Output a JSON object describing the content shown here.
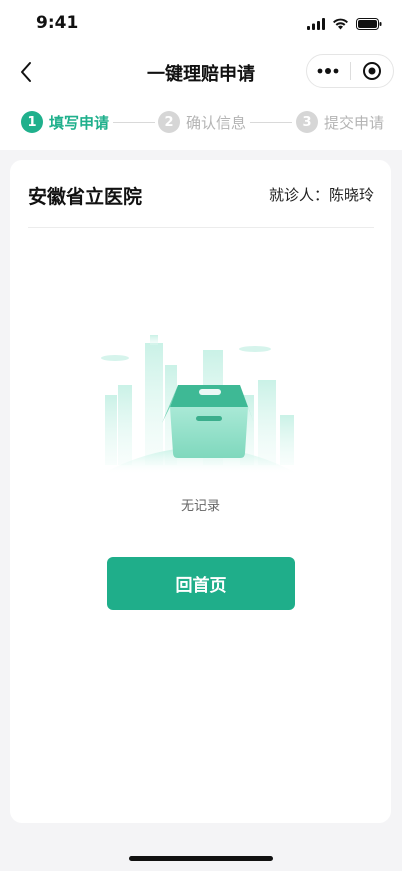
{
  "status_bar": {
    "time": "9:41"
  },
  "nav": {
    "title": "一键理赔申请",
    "back_icon": "chevron-left-icon",
    "more_icon": "more-dots-icon",
    "close_icon": "target-circle-icon"
  },
  "steps": [
    {
      "num": "1",
      "label": "填写申请",
      "state": "active"
    },
    {
      "num": "2",
      "label": "确认信息",
      "state": "inactive"
    },
    {
      "num": "3",
      "label": "提交申请",
      "state": "inactive"
    }
  ],
  "card": {
    "hospital": "安徽省立医院",
    "patient_label": "就诊人：",
    "patient_name": "陈晓玲",
    "empty_text": "无记录",
    "home_button": "回首页"
  },
  "colors": {
    "accent": "#1fae8a",
    "inactive": "#d6d6d6"
  }
}
